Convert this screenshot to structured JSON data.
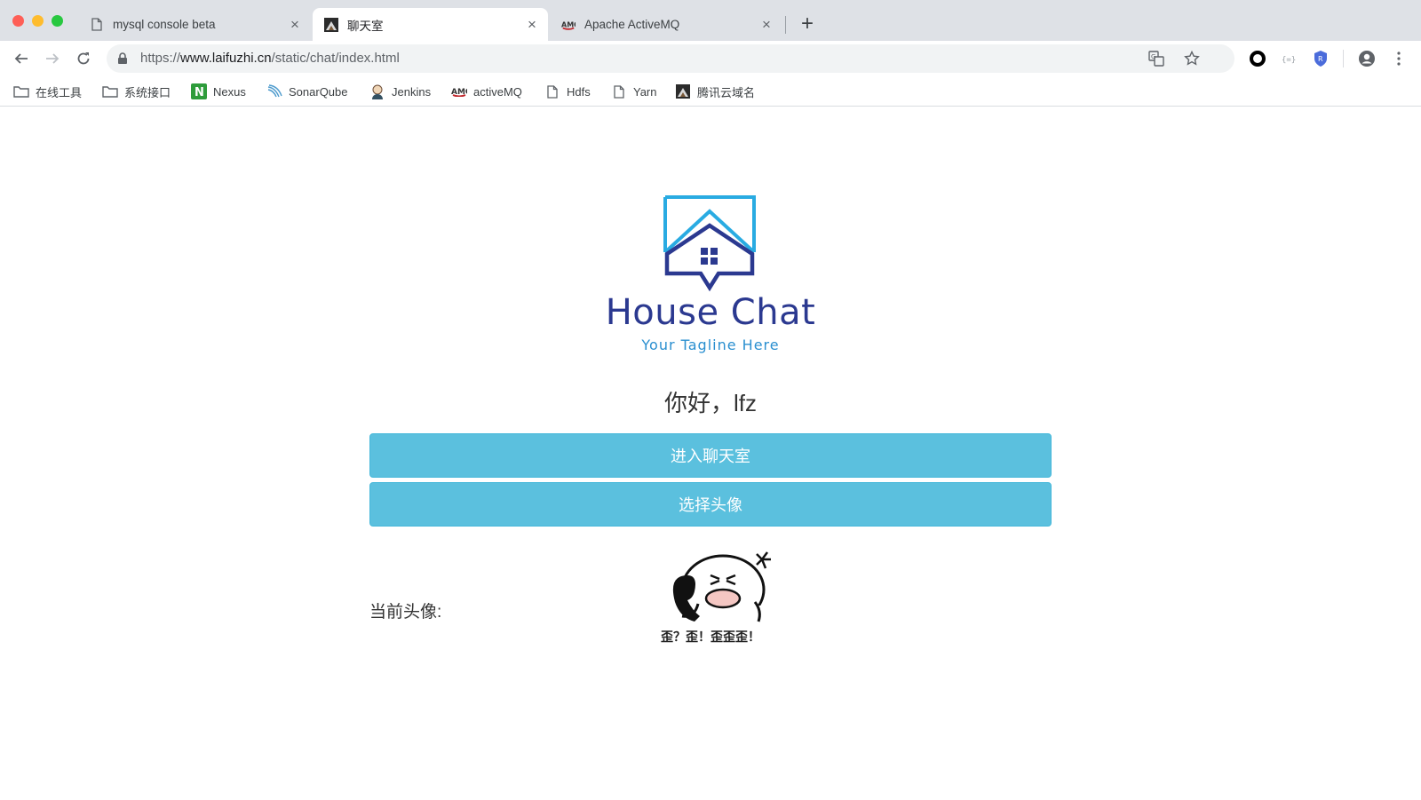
{
  "browser": {
    "tabs": [
      {
        "title": "mysql console beta",
        "favicon": "page-icon",
        "active": false
      },
      {
        "title": "聊天室",
        "favicon": "site-image-icon",
        "active": true
      },
      {
        "title": "Apache ActiveMQ",
        "favicon": "amq-icon",
        "active": false
      }
    ],
    "close_glyph": "×",
    "new_tab_glyph": "+",
    "url_scheme": "https://",
    "url_host": "www.laifuzhi.cn",
    "url_path": "/static/chat/index.html",
    "bookmarks": [
      {
        "label": "在线工具",
        "icon": "folder-icon"
      },
      {
        "label": "系统接口",
        "icon": "folder-icon"
      },
      {
        "label": "Nexus",
        "icon": "nexus-icon"
      },
      {
        "label": "SonarQube",
        "icon": "sonarqube-icon"
      },
      {
        "label": "Jenkins",
        "icon": "jenkins-icon"
      },
      {
        "label": "activeMQ",
        "icon": "amq-icon"
      },
      {
        "label": "Hdfs",
        "icon": "page-icon"
      },
      {
        "label": "Yarn",
        "icon": "page-icon"
      },
      {
        "label": "腾讯云域名",
        "icon": "site-image-icon"
      }
    ],
    "colors": {
      "tabstrip": "#dee1e6",
      "omnibox": "#f1f3f4"
    }
  },
  "page": {
    "brand_title": "House Chat",
    "tagline": "Your Tagline Here",
    "greeting": "你好，lfz",
    "enter_button": "进入聊天室",
    "choose_avatar_button": "选择头像",
    "current_avatar_label": "当前头像:",
    "avatar_caption": "歪？歪！歪歪歪！",
    "colors": {
      "brand": "#2b3990",
      "tagline": "#2a8fd0",
      "button": "#5bc0de",
      "logo_top": "#29abe2",
      "logo_house": "#2b3990"
    }
  }
}
